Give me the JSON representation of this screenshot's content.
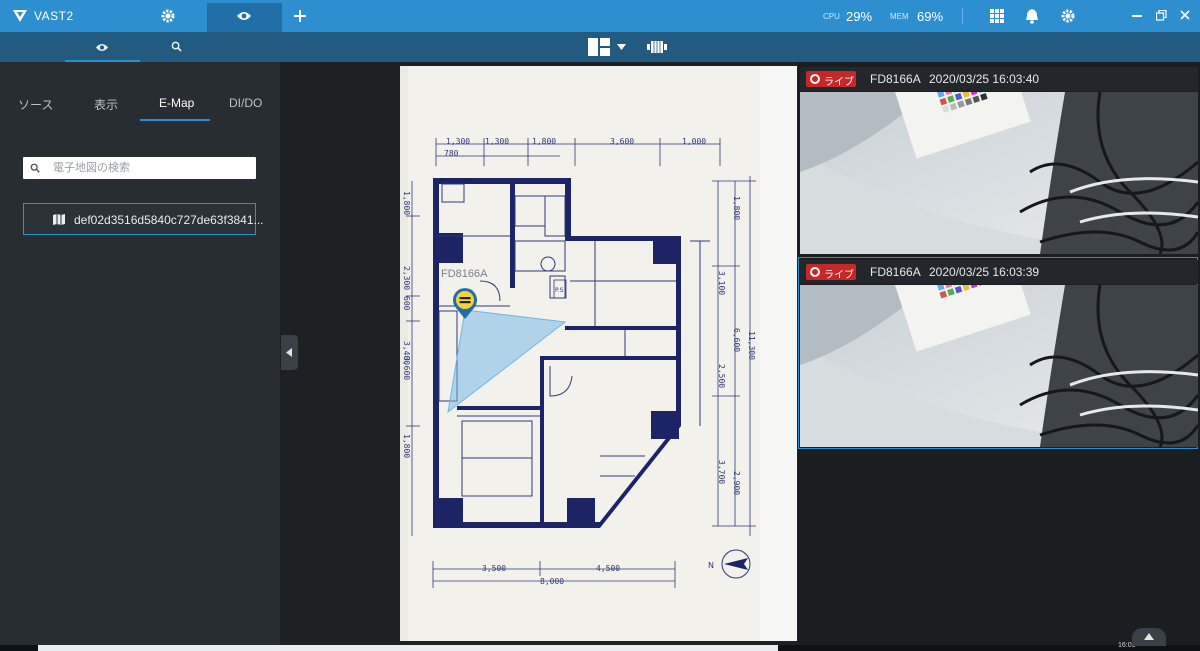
{
  "app": {
    "title": "VAST2",
    "stats": {
      "cpu_label": "CPU",
      "cpu_value": "29%",
      "mem_label": "MEM",
      "mem_value": "69%"
    }
  },
  "topbar_icons": [
    "gear-icon",
    "eye-icon",
    "plus-icon",
    "grid-icon",
    "bell-icon",
    "settings-icon",
    "minimize-icon",
    "restore-icon",
    "close-icon"
  ],
  "panel": {
    "tabs": [
      {
        "label": "ソース",
        "active": false
      },
      {
        "label": "表示",
        "active": false
      },
      {
        "label": "E-Map",
        "active": true
      },
      {
        "label": "DI/DO",
        "active": false
      }
    ],
    "search_placeholder": "電子地図の検索",
    "map_item": "def02d3516d5840c727de63f3841..."
  },
  "emap": {
    "camera_label": "FD8166A",
    "dims": {
      "top": [
        "1,300",
        "1,300",
        "1,800",
        "3,600",
        "1,000"
      ],
      "top_small": "780",
      "bottom": [
        "3,500",
        "4,500",
        "8,000"
      ],
      "left": [
        "1,800",
        "2,300",
        "600",
        "3,400",
        "3,600",
        "1,800"
      ],
      "right": [
        "1,800",
        "3,100",
        "6,600",
        "11,300",
        "2,500",
        "3,700",
        "2,900"
      ],
      "ps": "P.S"
    }
  },
  "cameras": [
    {
      "badge": "ライブ",
      "name": "FD8166A",
      "timestamp": "2020/03/25 16:03:40"
    },
    {
      "badge": "ライブ",
      "name": "FD8166A",
      "timestamp": "2020/03/25 16:03:39"
    }
  ],
  "colors": {
    "accent": "#2d8fcf",
    "live": "#c62828",
    "fov": "#6fb6e6",
    "marker": "#f2d43a"
  },
  "footer": {
    "time": "16:03"
  }
}
